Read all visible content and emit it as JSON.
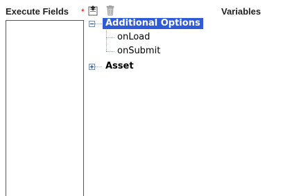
{
  "header": {
    "execute_fields_label": "Execute Fields",
    "required_marker": "*",
    "variables_label": "Variables"
  },
  "toolbar": {
    "insert_icon": "insert-field-icon",
    "delete_icon": "trash-icon"
  },
  "tree": {
    "nodes": [
      {
        "label": "Additional Options",
        "expanded": true,
        "selected": true,
        "children": [
          {
            "label": "onLoad"
          },
          {
            "label": "onSubmit"
          }
        ]
      },
      {
        "label": "Asset",
        "expanded": false
      }
    ]
  },
  "colors": {
    "selection": "#2f5cd6",
    "required": "#dd0000"
  }
}
